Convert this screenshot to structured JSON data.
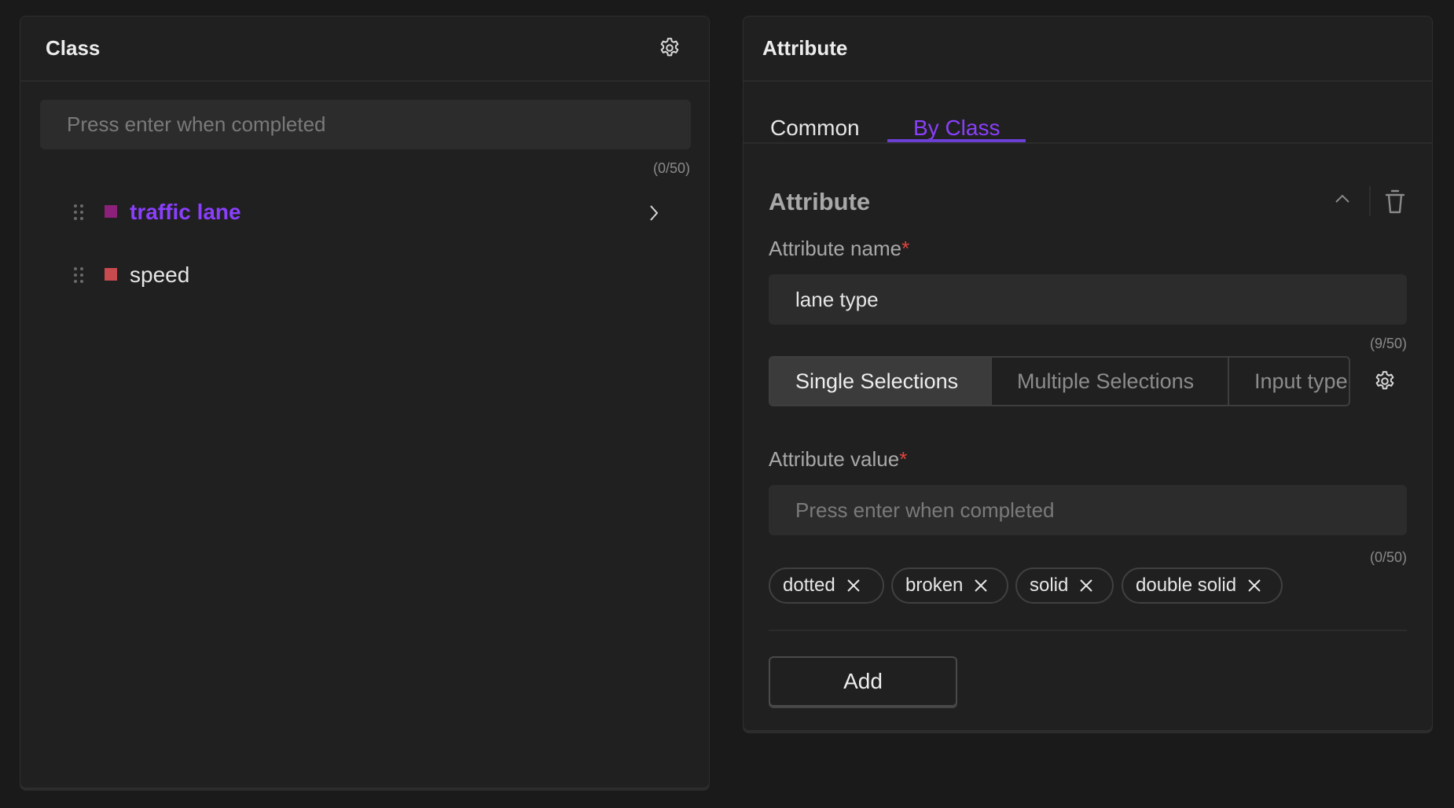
{
  "class_panel": {
    "title": "Class",
    "settings_icon": "gear-icon",
    "input": {
      "value": "",
      "placeholder": "Press enter when completed"
    },
    "counter": "(0/50)",
    "classes": [
      {
        "name": "traffic lane",
        "color": "#8b2178",
        "selected": true,
        "text_color": "#8a3ffc"
      },
      {
        "name": "speed",
        "color": "#c84b50",
        "selected": false,
        "text_color": "#e6e6e6"
      }
    ]
  },
  "attribute_panel": {
    "title": "Attribute",
    "tabs": [
      {
        "label": "Common",
        "active": false
      },
      {
        "label": "By Class",
        "active": true
      }
    ],
    "accent_color": "#8a3ffc",
    "section": {
      "title": "Attribute",
      "name_label": "Attribute name",
      "required_mark": "*",
      "name_input": {
        "value": "lane type",
        "placeholder": ""
      },
      "name_counter": "(9/50)",
      "selection_types": [
        {
          "label": "Single Selections",
          "active": true
        },
        {
          "label": "Multiple Selections",
          "active": false
        },
        {
          "label": "Input type",
          "active": false
        }
      ],
      "value_label": "Attribute value",
      "value_input": {
        "value": "",
        "placeholder": "Press enter when completed"
      },
      "value_counter": "(0/50)",
      "values": [
        "dotted",
        "broken",
        "solid",
        "double solid"
      ]
    },
    "add_button": "Add"
  }
}
